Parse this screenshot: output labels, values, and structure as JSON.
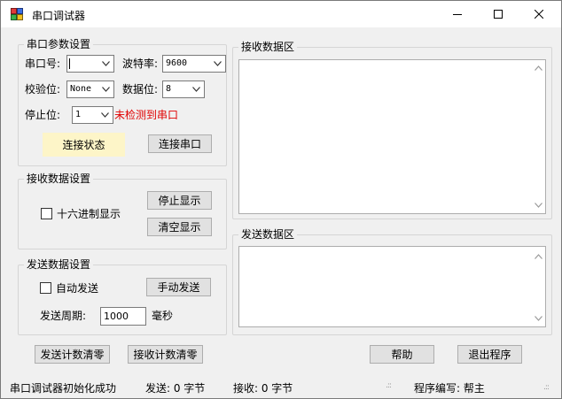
{
  "window": {
    "title": "串口调试器",
    "icon": "serial-port-app-icon"
  },
  "port_settings": {
    "title": "串口参数设置",
    "port_label": "串口号:",
    "port_value": "",
    "baud_label": "波特率:",
    "baud_value": "9600",
    "parity_label": "校验位:",
    "parity_value": "None",
    "databits_label": "数据位:",
    "databits_value": "8",
    "stopbits_label": "停止位:",
    "stopbits_value": "1",
    "port_status_text": "未检测到串口",
    "connection_status": "连接状态",
    "connect_button": "连接串口"
  },
  "receive_settings": {
    "title": "接收数据设置",
    "hex_display_label": "十六进制显示",
    "hex_display_checked": false,
    "stop_display_button": "停止显示",
    "clear_display_button": "清空显示"
  },
  "send_settings": {
    "title": "发送数据设置",
    "auto_send_label": "自动发送",
    "auto_send_checked": false,
    "manual_send_button": "手动发送",
    "period_label": "发送周期:",
    "period_value": "1000",
    "period_unit": "毫秒"
  },
  "receive_area": {
    "title": "接收数据区",
    "content": ""
  },
  "send_area": {
    "title": "发送数据区",
    "content": ""
  },
  "bottom_buttons": {
    "clear_send_count": "发送计数清零",
    "clear_receive_count": "接收计数清零",
    "help": "帮助",
    "exit": "退出程序"
  },
  "statusbar": {
    "message": "串口调试器初始化成功",
    "sent": "发送: 0 字节",
    "received": "接收: 0 字节",
    "author": "程序编写: 帮主"
  },
  "colors": {
    "status_box_bg": "#fdf5c8",
    "warning_text": "#e00000"
  }
}
